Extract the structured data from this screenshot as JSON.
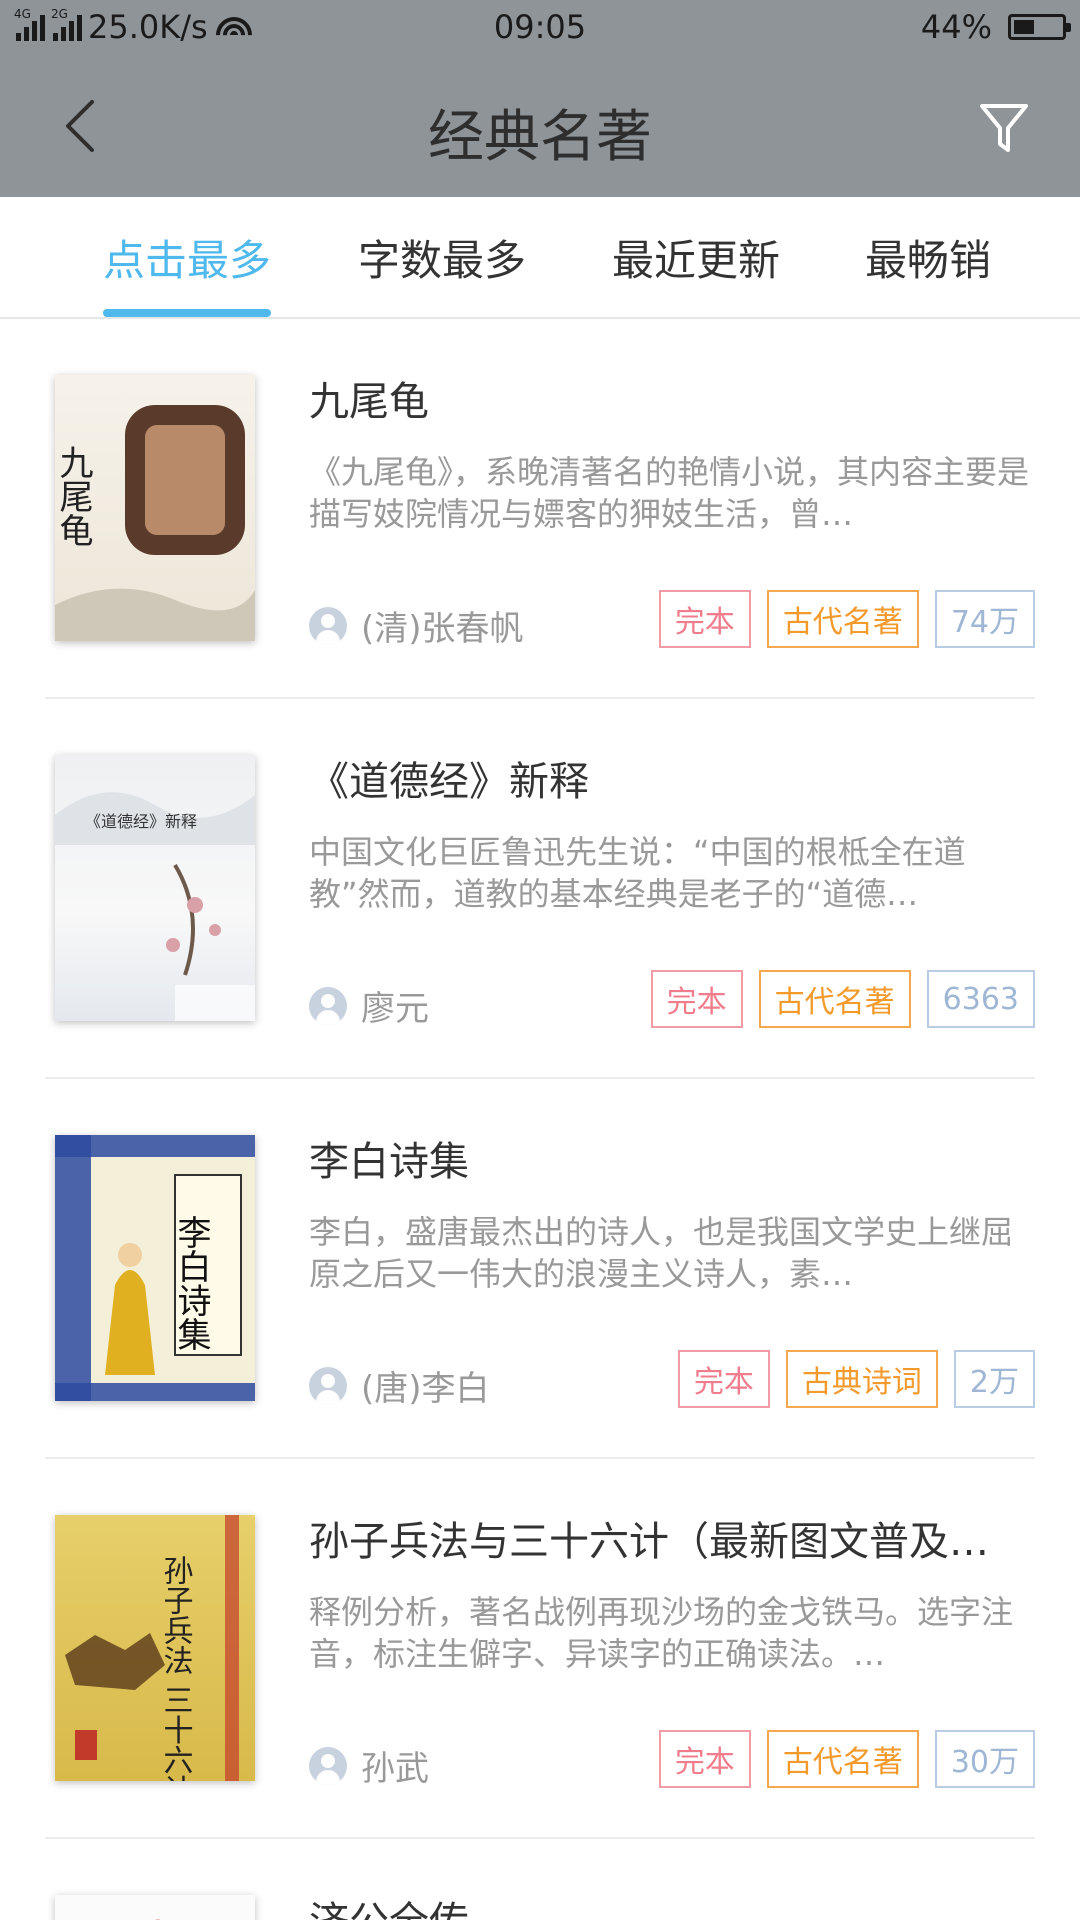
{
  "status_bar": {
    "network_left": "4G",
    "network_right": "2G",
    "speed": "25.0K/s",
    "time": "09:05",
    "battery_text": "44%",
    "battery_level": 0.44
  },
  "header": {
    "title": "经典名著",
    "back_icon": "chevron-left-icon",
    "filter_icon": "filter-icon"
  },
  "tabs": [
    {
      "label": "点击最多",
      "active": true
    },
    {
      "label": "字数最多",
      "active": false
    },
    {
      "label": "最近更新",
      "active": false
    },
    {
      "label": "最畅销",
      "active": false
    }
  ],
  "books": [
    {
      "title": "九尾龟",
      "description": "《九尾龟》，系晚清著名的艳情小说，其内容主要是描写妓院情况与嫖客的狎妓生活，曾…",
      "author": "(清)张春帆",
      "tags": [
        "完本",
        "古代名著",
        "74万"
      ],
      "cover_text": "九尾龟"
    },
    {
      "title": "《道德经》新释",
      "description": "中国文化巨匠鲁迅先生说：“中国的根柢全在道教”然而，道教的基本经典是老子的“道德…",
      "author": "廖元",
      "tags": [
        "完本",
        "古代名著",
        "6363"
      ],
      "cover_text": "《道德经》新释"
    },
    {
      "title": "李白诗集",
      "description": "李白，盛唐最杰出的诗人，也是我国文学史上继屈原之后又一伟大的浪漫主义诗人，素…",
      "author": "(唐)李白",
      "tags": [
        "完本",
        "古典诗词",
        "2万"
      ],
      "cover_text": "李白诗集"
    },
    {
      "title": "孙子兵法与三十六计（最新图文普及…",
      "description": "释例分析，著名战例再现沙场的金戈铁马。选字注音，标注生僻字、异读字的正确读法。…",
      "author": "孙武",
      "tags": [
        "完本",
        "古代名著",
        "30万"
      ],
      "cover_text": "孙子兵法 三十六计"
    },
    {
      "title": "济公全传"
    }
  ],
  "colors": {
    "accent": "#4fb8ec",
    "tag_red": "#f07c8c",
    "tag_orange": "#f39a2c",
    "tag_blue": "#9fb7d5",
    "header_bg": "#8f9498"
  }
}
